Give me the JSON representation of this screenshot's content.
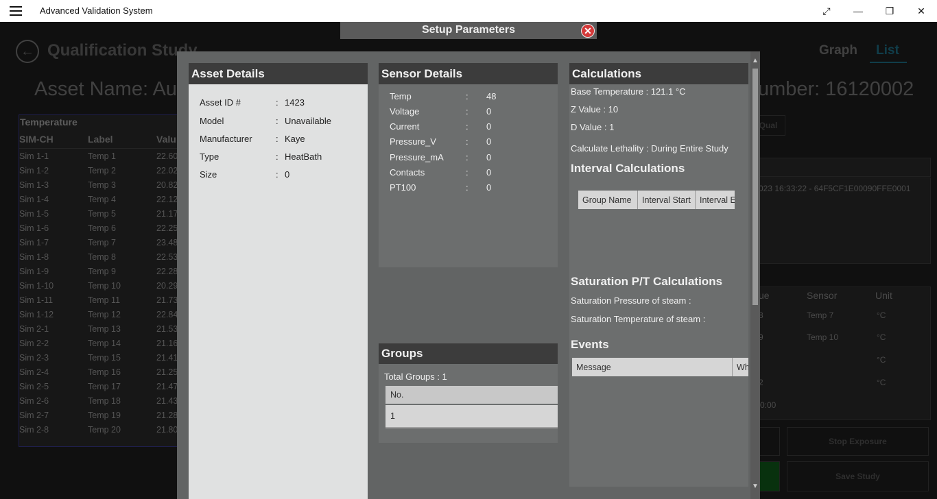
{
  "window": {
    "title": "Advanced Validation System",
    "controls": [
      "⤢",
      "—",
      "❐",
      "✕"
    ]
  },
  "background": {
    "study_title": "Qualification Study",
    "view_graph": "Graph",
    "view_list": "List",
    "asset_name_text": "Asset Name: Auro",
    "serial_text": "Number:  16120002",
    "temperature": {
      "title": "Temperature",
      "columns": [
        "SIM-CH",
        "Label",
        "Valu"
      ],
      "rows": [
        [
          "Sim 1-1",
          "Temp 1",
          "22.60"
        ],
        [
          "Sim 1-2",
          "Temp 2",
          "22.02"
        ],
        [
          "Sim 1-3",
          "Temp 3",
          "20.82"
        ],
        [
          "Sim 1-4",
          "Temp 4",
          "22.12"
        ],
        [
          "Sim 1-5",
          "Temp 5",
          "21.17"
        ],
        [
          "Sim 1-6",
          "Temp 6",
          "22.25"
        ],
        [
          "Sim 1-7",
          "Temp 7",
          "23.48"
        ],
        [
          "Sim 1-8",
          "Temp 8",
          "22.53"
        ],
        [
          "Sim 1-9",
          "Temp 9",
          "22.28"
        ],
        [
          "Sim 1-10",
          "Temp 10",
          "20.29"
        ],
        [
          "Sim 1-11",
          "Temp 11",
          "21.73"
        ],
        [
          "Sim 1-12",
          "Temp 12",
          "22.84"
        ],
        [
          "Sim 2-1",
          "Temp 13",
          "21.53"
        ],
        [
          "Sim 2-2",
          "Temp 14",
          "21.16"
        ],
        [
          "Sim 2-3",
          "Temp 15",
          "21.41"
        ],
        [
          "Sim 2-4",
          "Temp 16",
          "21.25"
        ],
        [
          "Sim 2-5",
          "Temp 17",
          "21.47"
        ],
        [
          "Sim 2-6",
          "Temp 18",
          "21.43"
        ],
        [
          "Sim 2-7",
          "Temp 19",
          "21.28"
        ],
        [
          "Sim 2-8",
          "Temp 20",
          "21.80"
        ]
      ]
    },
    "log_text": "023 16:33:22 - 64F5CF1E00090FFE0001",
    "qual_label": "Qual",
    "sensor_table": {
      "columns": [
        "ue",
        "Sensor",
        "Unit"
      ],
      "rows": [
        [
          "8",
          "Temp 7",
          "°C"
        ],
        [
          "9",
          "Temp 10",
          "°C"
        ],
        [
          "",
          "",
          "°C"
        ],
        [
          "2",
          "",
          "°C"
        ]
      ],
      "time": "0:00"
    },
    "stop_exposure": "Stop Exposure",
    "save_study": "Save Study"
  },
  "dialog": {
    "title": "Setup Parameters",
    "close_icon": "close-icon",
    "asset": {
      "header": "Asset Details",
      "fields": [
        {
          "label": "Asset ID #",
          "value": "1423"
        },
        {
          "label": "Model",
          "value": "Unavailable"
        },
        {
          "label": "Manufacturer",
          "value": "Kaye"
        },
        {
          "label": "Type",
          "value": "HeatBath"
        },
        {
          "label": "Size",
          "value": "0"
        }
      ]
    },
    "sensor": {
      "header": "Sensor Details",
      "fields": [
        {
          "label": "Temp",
          "value": "48"
        },
        {
          "label": "Voltage",
          "value": "0"
        },
        {
          "label": "Current",
          "value": "0"
        },
        {
          "label": "Pressure_V",
          "value": "0"
        },
        {
          "label": "Pressure_mA",
          "value": "0"
        },
        {
          "label": "Contacts",
          "value": "0"
        },
        {
          "label": "PT100",
          "value": "0"
        }
      ]
    },
    "groups": {
      "header": "Groups",
      "total": "Total Groups : 1",
      "column": "No.",
      "rows": [
        "1"
      ]
    },
    "calculations": {
      "header": "Calculations",
      "base_temperature": "Base Temperature  :  121.1 °C",
      "z_value": "Z Value  :  10",
      "d_value": "D Value  :  1",
      "lethality": "Calculate Lethality  :  During Entire Study",
      "interval_header": "Interval Calculations",
      "interval_columns": [
        "Group Name",
        "Interval Start",
        "Interval E"
      ],
      "saturation_header": "Saturation P/T Calculations",
      "saturation_pressure": "Saturation Pressure of steam :",
      "saturation_temperature": "Saturation Temperature of steam :",
      "events_header": "Events",
      "event_columns": [
        "Message",
        "Wh"
      ]
    }
  },
  "colors": {
    "close_red": "#d43a3a",
    "accent_teal": "#1e6f87",
    "header_dark": "#3c3c3c",
    "panel_gray": "#6c6e6e",
    "asset_panel_bg": "#e0e1e1"
  }
}
